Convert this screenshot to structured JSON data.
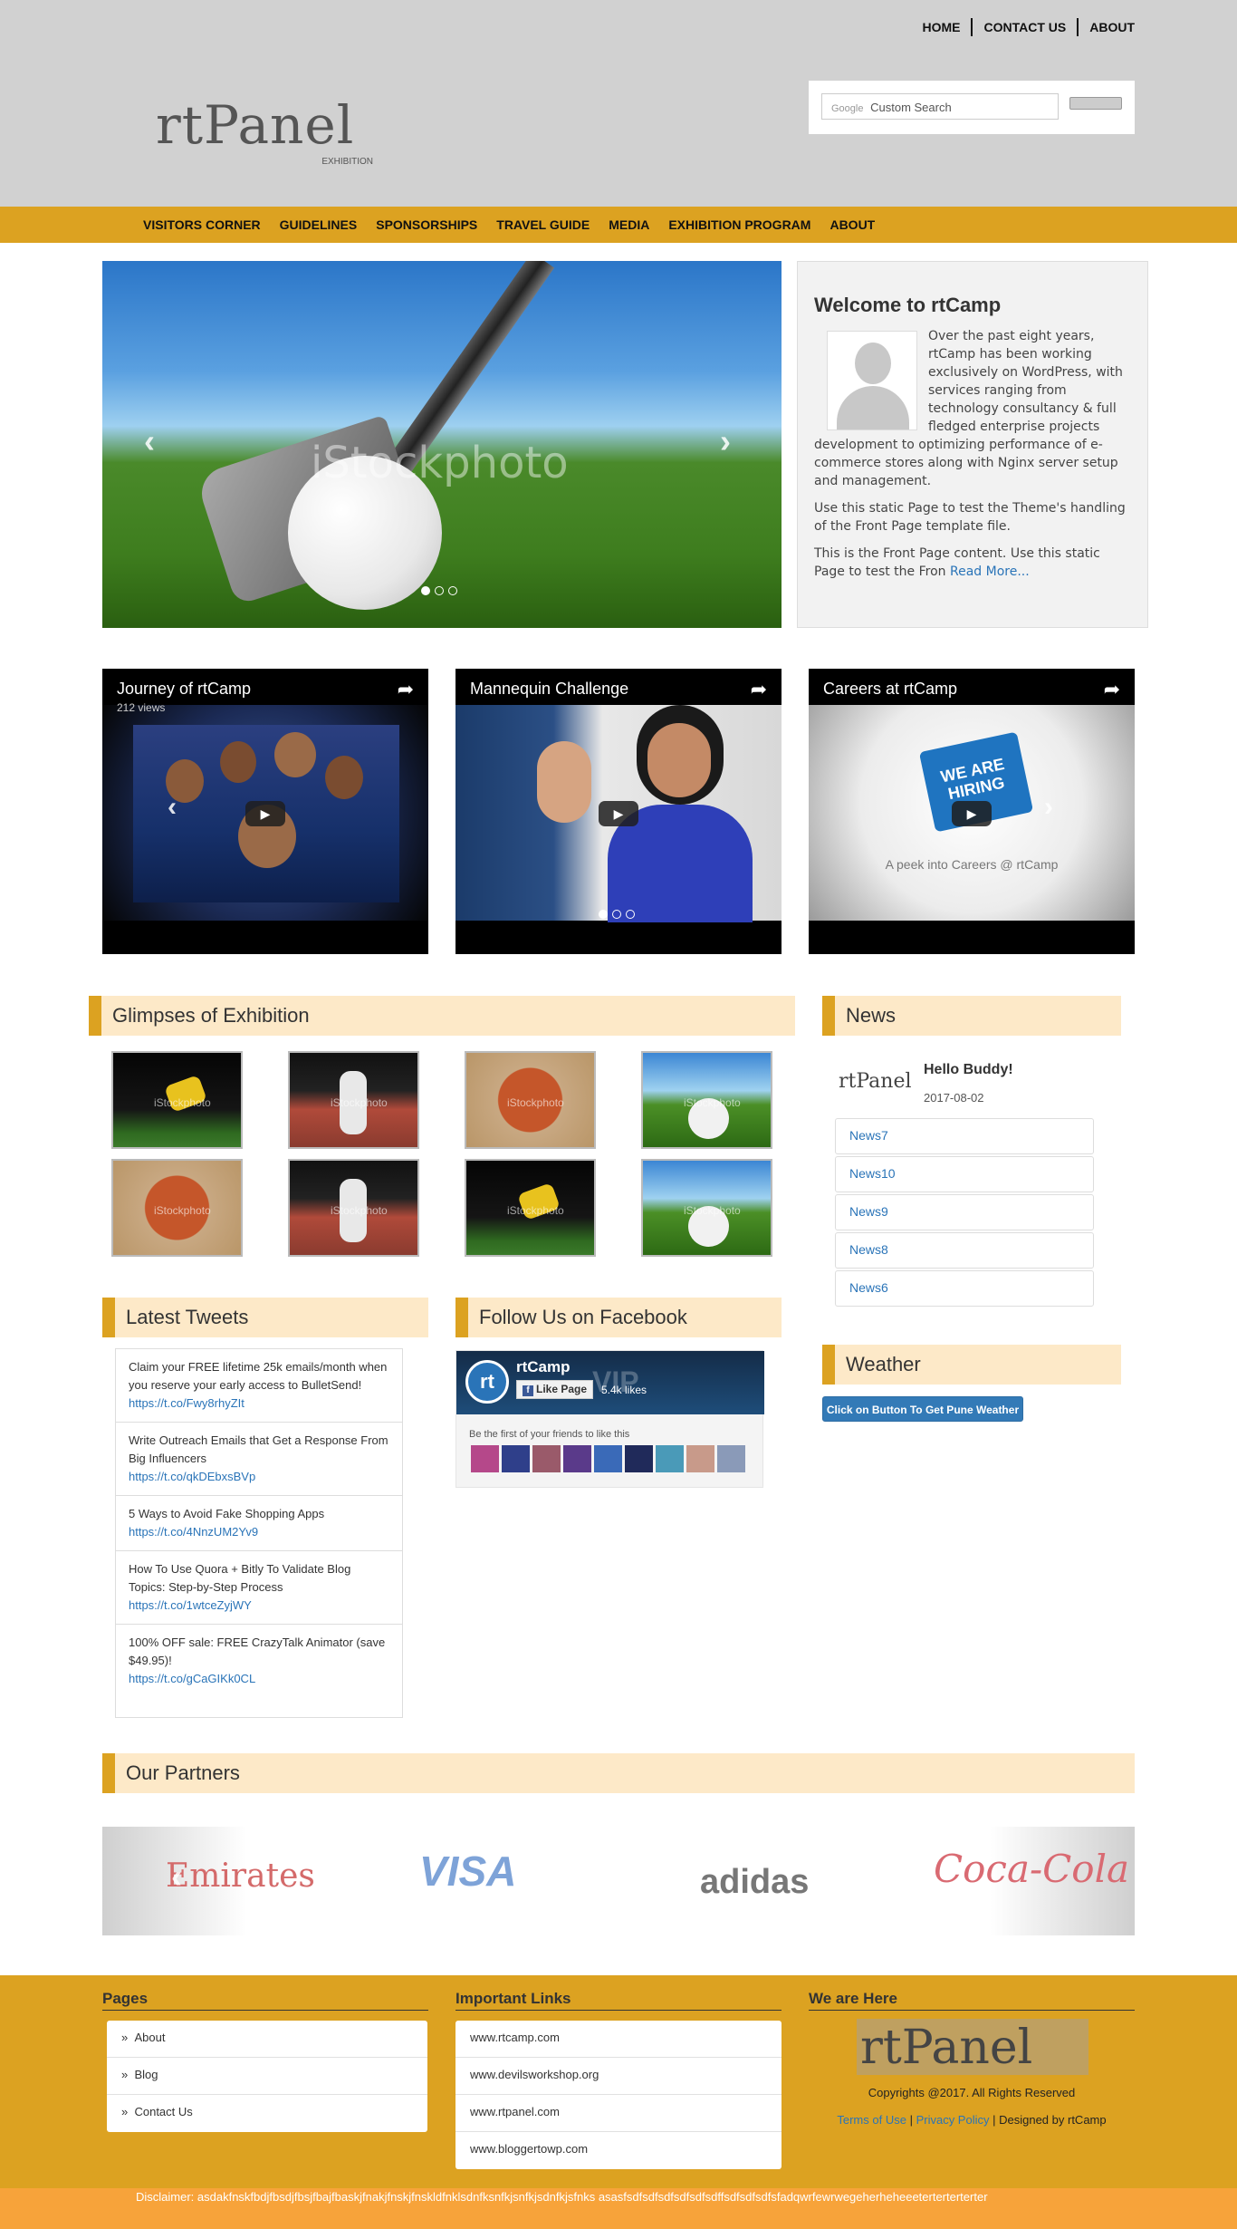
{
  "topnav": [
    "HOME",
    "CONTACT US",
    "ABOUT"
  ],
  "logo": {
    "text": "rtPanel",
    "sub": "EXHIBITION"
  },
  "search": {
    "brand": "Google",
    "placeholder": "Custom Search"
  },
  "mainnav": [
    "VISITORS CORNER",
    "GUIDELINES",
    "SPONSORSHIPS",
    "TRAVEL GUIDE",
    "MEDIA",
    "EXHIBITION PROGRAM",
    "ABOUT"
  ],
  "hero": {
    "watermark": "iStockphoto"
  },
  "welcome": {
    "title": "Welcome to rtCamp",
    "p1": "Over the past eight years, rtCamp has been working exclusively on WordPress, with services ranging from technology consultancy & full fledged enterprise projects development to optimizing performance of e-commerce stores along with Nginx server setup and management.",
    "p2": "Use this static Page to test the Theme's handling of the Front Page template file.",
    "p3": "This is the Front Page content. Use this static Page to test the Fron",
    "read_more": "Read More..."
  },
  "videos": [
    {
      "title": "Journey of rtCamp",
      "views": "212 views"
    },
    {
      "title": "Mannequin Challenge",
      "views": ""
    },
    {
      "title": "Careers at rtCamp",
      "views": "",
      "sign": "WE ARE HIRING",
      "caption": "A peek into Careers @ rtCamp"
    }
  ],
  "sections": {
    "glimpses": "Glimpses of Exhibition",
    "news": "News",
    "weather": "Weather",
    "tweets": "Latest Tweets",
    "facebook": "Follow Us on Facebook",
    "partners": "Our Partners"
  },
  "gallery_watermark": "iStockphoto",
  "news": {
    "logo": "rtPanel",
    "headline": "Hello Buddy!",
    "date": "2017-08-02",
    "items": [
      "News7",
      "News10",
      "News9",
      "News8",
      "News6"
    ]
  },
  "weather": {
    "button": "Click on Button To Get Pune Weather"
  },
  "tweets": [
    {
      "text": "Claim your FREE lifetime 25k emails/month when you reserve your early access to BulletSend!",
      "link": "https://t.co/Fwy8rhyZIt"
    },
    {
      "text": "Write Outreach Emails that Get a Response From Big Influencers",
      "link": "https://t.co/qkDEbxsBVp"
    },
    {
      "text": "5 Ways to Avoid Fake Shopping Apps",
      "link": "https://t.co/4NnzUM2Yv9"
    },
    {
      "text": "How To Use Quora + Bitly To Validate Blog Topics: Step-by-Step Process",
      "link": "https://t.co/1wtceZyjWY"
    },
    {
      "text": "100% OFF sale: FREE CrazyTalk Animator (save $49.95)!",
      "link": "https://t.co/gCaGIKk0CL"
    }
  ],
  "facebook": {
    "page": "rtCamp",
    "like": "Like Page",
    "likes": "5.4k likes",
    "friends": "Be the first of your friends to like this",
    "logo": "rt",
    "wm": "VIP"
  },
  "partners": [
    "Emirates",
    "VISA",
    "adidas",
    "Coca-Cola"
  ],
  "footer": {
    "pages_title": "Pages",
    "pages": [
      "About",
      "Blog",
      "Contact Us"
    ],
    "links_title": "Important Links",
    "links": [
      "www.rtcamp.com",
      "www.devilsworkshop.org",
      "www.rtpanel.com",
      "www.bloggertowp.com"
    ],
    "here_title": "We are Here",
    "logo": "rtPanel",
    "copyright": "Copyrights @2017. All Rights Reserved",
    "terms": "Terms of Use",
    "privacy": "Privacy Policy",
    "designed": "| Designed by rtCamp",
    "sep": "|"
  },
  "disclaimer": "Disclaimer: asdakfnskfbdjfbsdjfbsjfbajfbaskjfnakjfnskjfnskldfnklsdnfksnfkjsnfkjsdnfkjsfnks asasfsdfsdfsdfsdfsdfsdffsdfsdfsdfsfadqwrfewrwegeherheheeeterterterterter",
  "colors": {
    "accent": "#dca221",
    "section_bg": "#fde9c8",
    "header_bg": "#d1d1d1",
    "link": "#2a74b8",
    "disclaimer_bg": "#f7a33a"
  }
}
